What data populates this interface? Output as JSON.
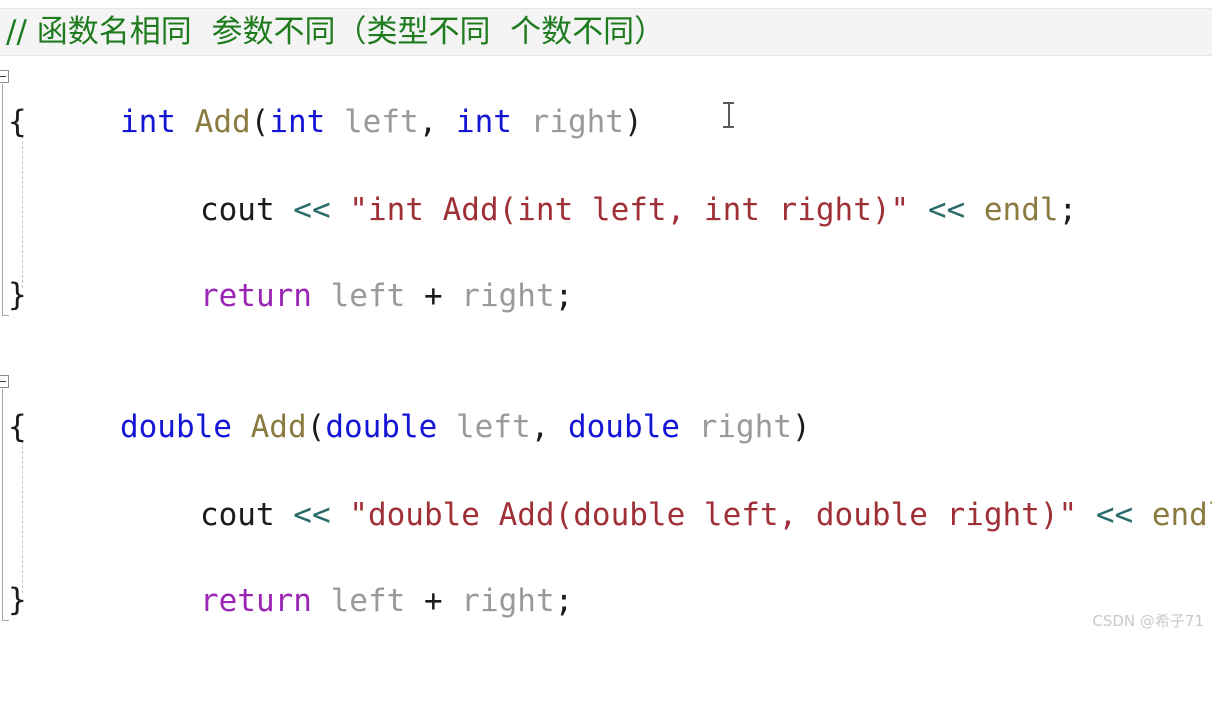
{
  "editor": {
    "language": "cpp",
    "background_color": "#ffffff",
    "comment_band_color": "#f4f4f4",
    "colors": {
      "keyword": "#1515d6",
      "function": "#8a7b41",
      "parameter": "#9a9a9a",
      "string": "#a03038",
      "operator": "#2b6b6b",
      "return_keyword": "#9b26b6",
      "punctuation": "#1b1b1b",
      "comment": "#1e7b1e"
    }
  },
  "comment_line": {
    "text": "// 函数名相同  参数不同（类型不同  个数不同）"
  },
  "func_int": {
    "keyword": "int",
    "name": "Add",
    "open_paren": "(",
    "p1_type": "int",
    "p1_name": "left",
    "comma": ", ",
    "p2_type": "int",
    "p2_name": "right",
    "close_paren": ")",
    "brace_open": "{",
    "brace_close": "}",
    "cout": "cout",
    "shift_op": " << ",
    "string": "\"int Add(int left, int right)\"",
    "endl": "endl",
    "semicolon": ";",
    "return_kw": "return",
    "return_expr_left": " left ",
    "return_plus": "+",
    "return_expr_right": " right",
    "return_semicolon": ";"
  },
  "func_double": {
    "keyword": "double",
    "name": "Add",
    "open_paren": "(",
    "p1_type": "double",
    "p1_name": "left",
    "comma": ", ",
    "p2_type": "double",
    "p2_name": "right",
    "close_paren": ")",
    "brace_open": "{",
    "brace_close": "}",
    "cout": "cout",
    "shift_op": " << ",
    "string": "\"double Add(double left, double right)\"",
    "endl": "endl",
    "semicolon": ";",
    "return_kw": "return",
    "return_expr_left": " left ",
    "return_plus": "+",
    "return_expr_right": " right",
    "return_semicolon": ";"
  },
  "watermark": {
    "text": "CSDN @希子71"
  }
}
